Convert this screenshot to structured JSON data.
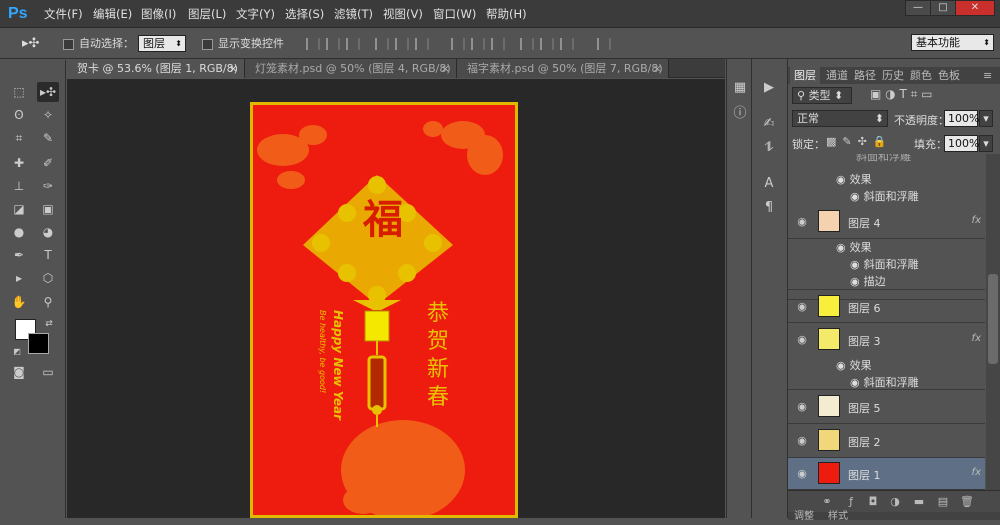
{
  "app": {
    "logo": "Ps"
  },
  "menu": [
    "文件(F)",
    "编辑(E)",
    "图像(I)",
    "图层(L)",
    "文字(Y)",
    "选择(S)",
    "滤镜(T)",
    "视图(V)",
    "窗口(W)",
    "帮助(H)"
  ],
  "window_buttons": {
    "minimize": "—",
    "restore": "□",
    "close": "✕"
  },
  "options": {
    "auto_select_label": "自动选择：",
    "auto_select_value": "图层",
    "show_transform_label": "显示变换控件",
    "workspace": "基本功能"
  },
  "tabs": [
    {
      "label": "贺卡 @ 53.6% (图层 1, RGB/8) *",
      "close": "×"
    },
    {
      "label": "灯笼素材.psd @ 50% (图层 4, RGB/8) *",
      "close": "×"
    },
    {
      "label": "福字素材.psd @ 50% (图层 7, RGB/8) *",
      "close": "×"
    }
  ],
  "artwork": {
    "fu_char": "福",
    "greeting_cn": [
      "恭",
      "贺",
      "新",
      "春"
    ],
    "greeting_en_1": "Happy New Year",
    "greeting_en_2": "Be healthy, be good!"
  },
  "panel": {
    "tabs": [
      "图层",
      "通道",
      "路径",
      "历史",
      "颜色",
      "色板"
    ],
    "filter_type": "类型",
    "blend_mode": "正常",
    "opacity_label": "不透明度：",
    "opacity_value": "100%",
    "lock_label": "锁定：",
    "fill_label": "填充：",
    "fill_value": "100%",
    "bottom_tabs": [
      "调整",
      "样式"
    ]
  },
  "layers": {
    "partial_top": "斜面和浮雕",
    "effects_a": [
      "效果",
      "斜面和浮雕"
    ],
    "layer4": "图层 4",
    "effects_b": [
      "效果",
      "斜面和浮雕",
      "描边"
    ],
    "layer6": "图层 6",
    "layer3": "图层 3",
    "effects_c": [
      "效果",
      "斜面和浮雕"
    ],
    "layer5": "图层 5",
    "layer2": "图层 2",
    "layer1": "图层 1",
    "fx": "fx"
  },
  "colors": {
    "card_red": "#ee1c0e",
    "gold": "#e8c200",
    "selected_layer": "#5e6f86"
  }
}
